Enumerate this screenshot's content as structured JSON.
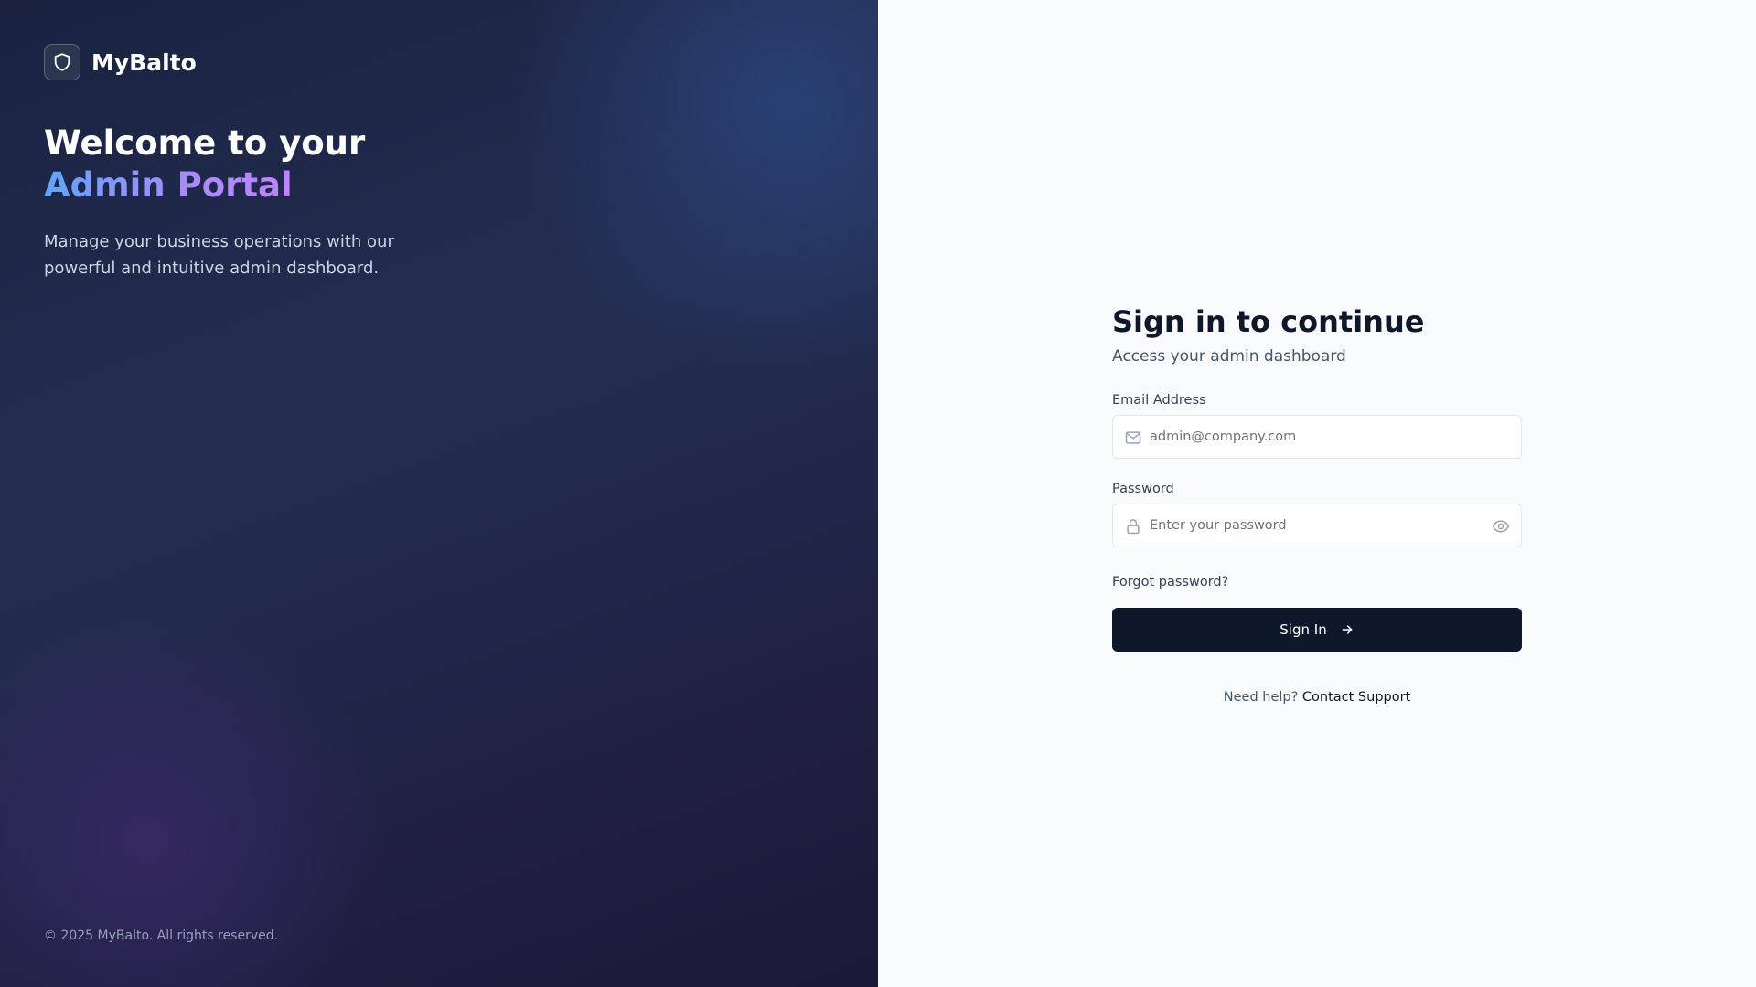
{
  "brand": {
    "name": "MyBalto",
    "icon": "shield-icon"
  },
  "hero": {
    "title_line1": "Welcome to your",
    "title_line2": "Admin Portal",
    "subtitle": "Manage your business operations with our powerful and intuitive admin dashboard."
  },
  "footer": {
    "copyright": "© 2025 MyBalto. All rights reserved."
  },
  "form": {
    "title": "Sign in to continue",
    "subtitle": "Access your admin dashboard",
    "email": {
      "label": "Email Address",
      "placeholder": "admin@company.com",
      "value": "",
      "icon": "mail-icon"
    },
    "password": {
      "label": "Password",
      "placeholder": "Enter your password",
      "value": "",
      "icon": "lock-icon",
      "toggle_icon": "eye-icon"
    },
    "forgot_label": "Forgot password?",
    "submit_label": "Sign In",
    "submit_icon": "arrow-right-icon",
    "help_text": "Need help?",
    "help_link": "Contact Support"
  },
  "colors": {
    "primary": "#0f172a",
    "accent_gradient_start": "#60a5fa",
    "accent_gradient_end": "#c084fc",
    "left_panel_bg": "#1f2747",
    "right_panel_bg": "#f8fafc"
  }
}
